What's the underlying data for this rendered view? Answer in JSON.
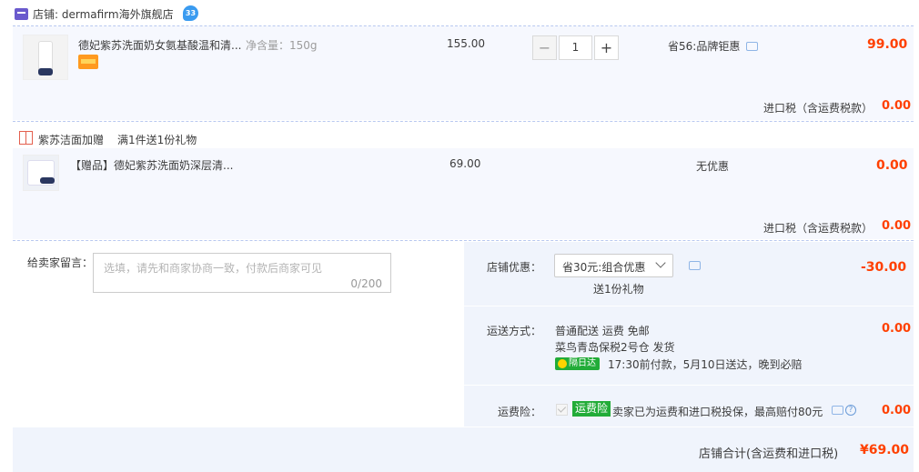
{
  "store": {
    "label": "店铺: dermafirm海外旗舰店",
    "ww_badge": "33"
  },
  "item": {
    "title": "德妃紫苏洗面奶女氨基酸温和清...",
    "spec": "净含量：150g",
    "unit_price": "155.00",
    "quantity": "1",
    "minus": "−",
    "plus": "+",
    "promo": "省56:品牌钜惠",
    "total": "99.00",
    "tax_label": "进口税（含运费税款）",
    "tax_value": "0.00"
  },
  "gift_group": {
    "label": "紫苏洁面加赠",
    "rule": "满1件送1份礼物"
  },
  "gift_item": {
    "title": "【赠品】德妃紫苏洗面奶深层清...",
    "unit_price": "69.00",
    "promo": "无优惠",
    "total": "0.00",
    "tax_label": "进口税（含运费税款）",
    "tax_value": "0.00"
  },
  "message": {
    "label": "给卖家留言：",
    "placeholder": "选填，请先和商家协商一致，付款后商家可见",
    "counter": "0/200"
  },
  "store_discount": {
    "label": "店铺优惠：",
    "selected": "省30元:组合优惠",
    "note": "送1份礼物",
    "value": "-30.00"
  },
  "shipping": {
    "label": "运送方式：",
    "line1": "普通配送 运费 免邮",
    "line2": "菜鸟青岛保税2号仓   发货",
    "badge": "隔日达",
    "line3": "17:30前付款，5月10日送达，晚到必赔",
    "value": "0.00"
  },
  "insurance": {
    "label": "运费险：",
    "badge": "运费险",
    "text": "卖家已为运费和进口税投保，最高赔付80元",
    "value": "0.00"
  },
  "summary": {
    "label": "店铺合计(含运费和进口税)",
    "value": "¥69.00"
  },
  "colors": {
    "price_red": "#ff4000",
    "accent_blue": "#3a9bf0",
    "green_badge": "#22ac38",
    "panel_bg": "#f0f4fc"
  }
}
